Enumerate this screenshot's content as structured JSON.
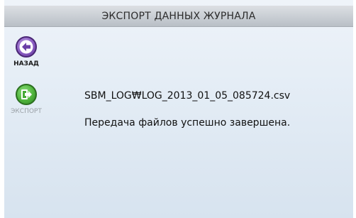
{
  "header": {
    "title": "ЭКСПОРТ ДАННЫХ ЖУРНАЛА"
  },
  "sidebar": {
    "back": {
      "label": "НАЗАД",
      "icon": "arrow-left-icon",
      "color": "#7a4fb5"
    },
    "export": {
      "label": "ЭКСПОРТ",
      "icon": "export-icon",
      "color": "#46a935"
    }
  },
  "main": {
    "filename": "SBM_LOG₩LOG_2013_01_05_085724.csv",
    "status": "Передача файлов успешно завершена."
  }
}
